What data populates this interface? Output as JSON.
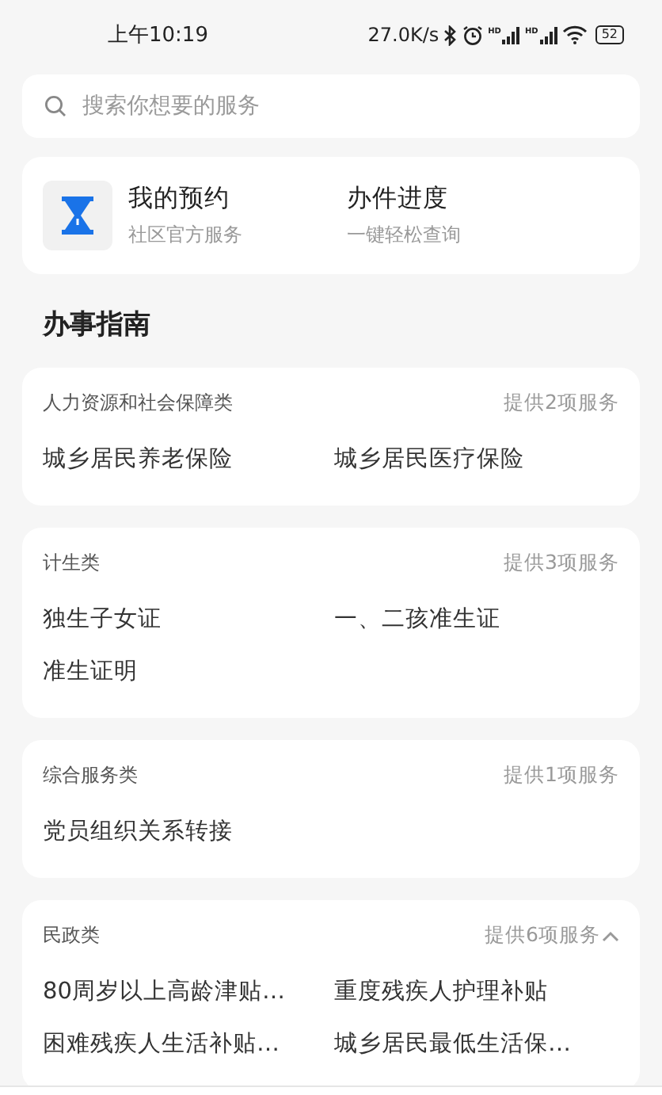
{
  "status_bar": {
    "time": "上午10:19",
    "speed": "27.0K/s",
    "signals": [
      {
        "label": "HD"
      },
      {
        "label": "HD"
      }
    ],
    "battery": "52"
  },
  "search": {
    "placeholder": "搜索你想要的服务"
  },
  "shortcuts": [
    {
      "title": "我的预约",
      "subtitle": "社区官方服务",
      "kind": "icon"
    },
    {
      "title": "办件进度",
      "subtitle": "一键轻松查询",
      "kind": "plain"
    }
  ],
  "section_title": "办事指南",
  "groups": [
    {
      "name": "人力资源和社会保障类",
      "count": "提供2项服务",
      "items": [
        "城乡居民养老保险",
        "城乡居民医疗保险"
      ]
    },
    {
      "name": "计生类",
      "count": "提供3项服务",
      "items": [
        "独生子女证",
        "一、二孩准生证",
        "准生证明"
      ]
    },
    {
      "name": "综合服务类",
      "count": "提供1项服务",
      "items": [
        "党员组织关系转接"
      ]
    },
    {
      "name": "民政类",
      "count": "提供6项服务",
      "expanded": true,
      "items": [
        "80周岁以上高龄津贴…",
        "重度残疾人护理补贴",
        "困难残疾人生活补贴…",
        "城乡居民最低生活保…"
      ]
    }
  ]
}
